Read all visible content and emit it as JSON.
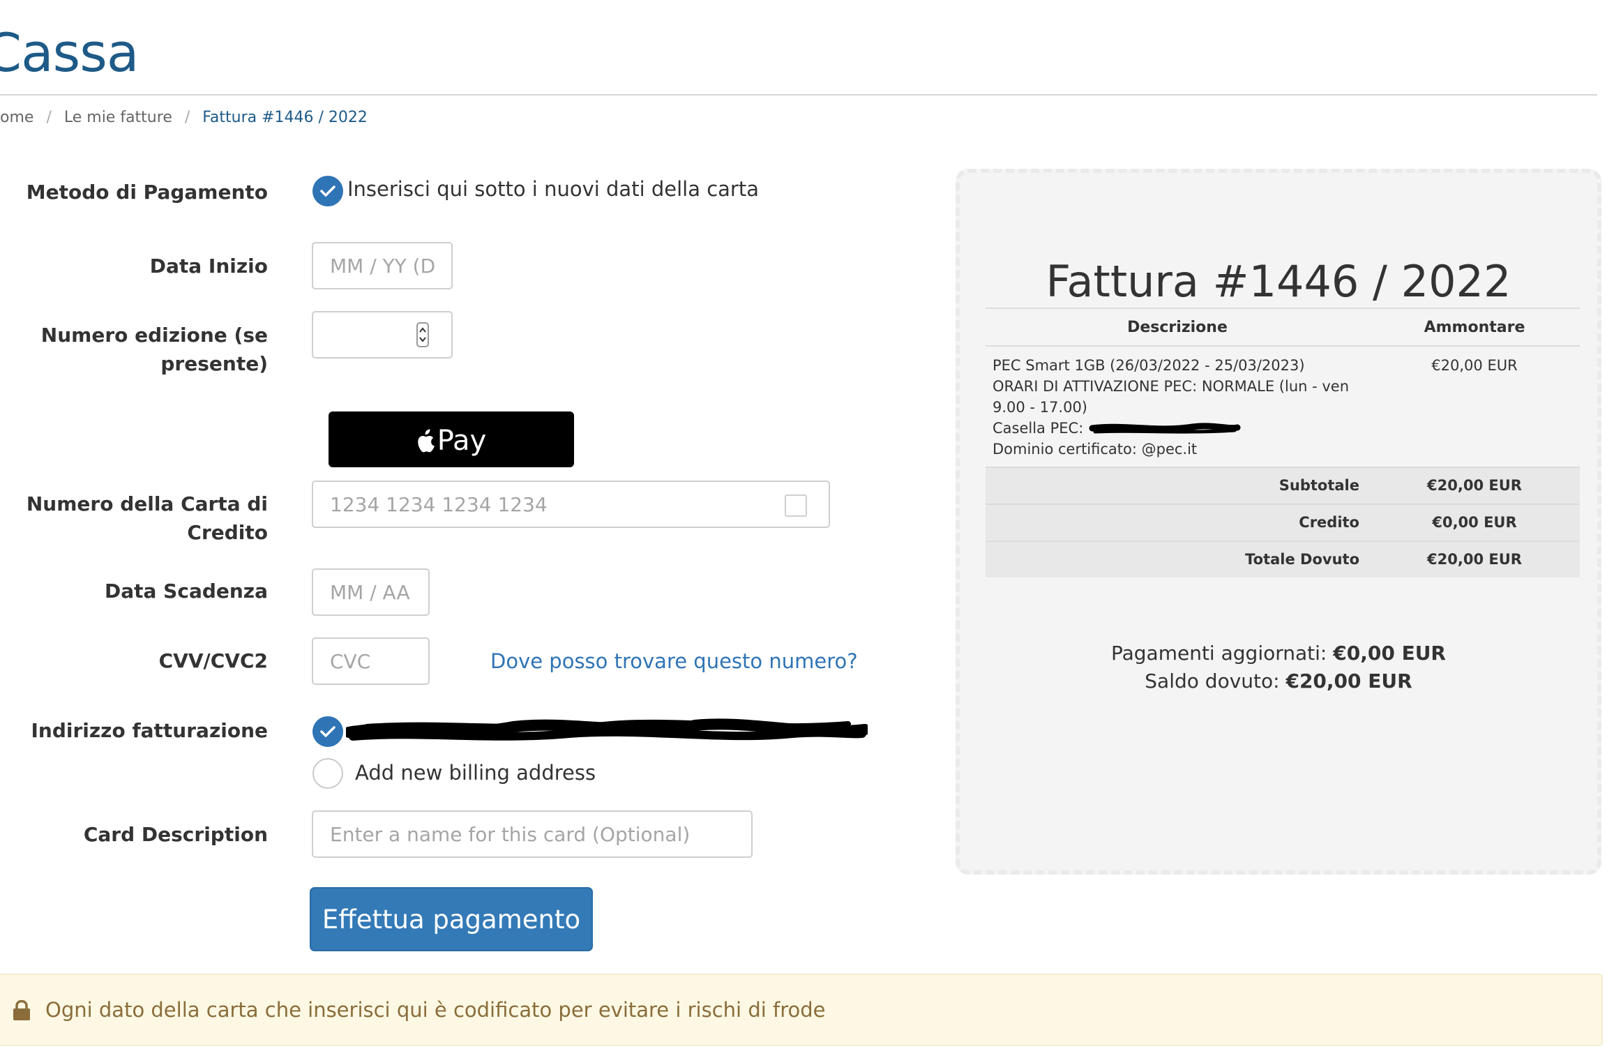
{
  "page": {
    "title": "Cassa"
  },
  "breadcrumb": [
    {
      "label": "ome"
    },
    {
      "label": "Le mie fatture"
    },
    {
      "label": "Fattura #1446 / 2022"
    }
  ],
  "form": {
    "payment_method": {
      "label": "Metodo di Pagamento",
      "option_label": "Inserisci qui sotto i nuovi dati della carta",
      "checked": true
    },
    "start_date": {
      "label": "Data Inizio",
      "placeholder": "MM / YY (Da",
      "value": ""
    },
    "issue_number": {
      "label_line1": "Numero edizione (se",
      "label_line2": "presente)",
      "value": ""
    },
    "apple_pay": {
      "label": "Pay"
    },
    "card_number": {
      "label_line1": "Numero della Carta di",
      "label_line2": "Credito",
      "placeholder": "1234 1234 1234 1234",
      "value": ""
    },
    "expiry_date": {
      "label": "Data Scadenza",
      "placeholder": "MM / AA",
      "value": ""
    },
    "cvv": {
      "label": "CVV/CVC2",
      "placeholder": "CVC",
      "value": "",
      "help_link": "Dove posso trovare questo numero?"
    },
    "billing_address": {
      "label": "Indirizzo fatturazione",
      "new_option_label": "Add new billing address"
    },
    "card_description": {
      "label": "Card Description",
      "placeholder": "Enter a name for this card (Optional)",
      "value": ""
    },
    "submit_label": "Effettua pagamento"
  },
  "security_notice": "Ogni dato della carta che inserisci qui è codificato per evitare i rischi di frode",
  "invoice": {
    "title": "Fattura #1446 / 2022",
    "columns": {
      "description": "Descrizione",
      "amount": "Ammontare"
    },
    "item": {
      "line1": "PEC Smart 1GB (26/03/2022 - 25/03/2023)",
      "line2": "ORARI DI ATTIVAZIONE PEC: NORMALE (lun - ven",
      "line3": "9.00 - 17.00)",
      "line4_label": "Casella PEC:",
      "line5": "Dominio certificato: @pec.it",
      "amount": "€20,00 EUR"
    },
    "totals": [
      {
        "label": "Subtotale",
        "value": "€20,00 EUR"
      },
      {
        "label": "Credito",
        "value": "€0,00 EUR"
      },
      {
        "label": "Totale Dovuto",
        "value": "€20,00 EUR"
      }
    ],
    "payments_label": "Pagamenti aggiornati:",
    "payments_value": "€0,00 EUR",
    "balance_label": "Saldo dovuto:",
    "balance_value": "€20,00 EUR"
  },
  "colors": {
    "brand_blue": "#1e5a87",
    "link_blue": "#2f74b5",
    "button_blue": "#337ab7",
    "notice_bg": "#fcf8e3",
    "notice_text": "#8a6d3b"
  }
}
